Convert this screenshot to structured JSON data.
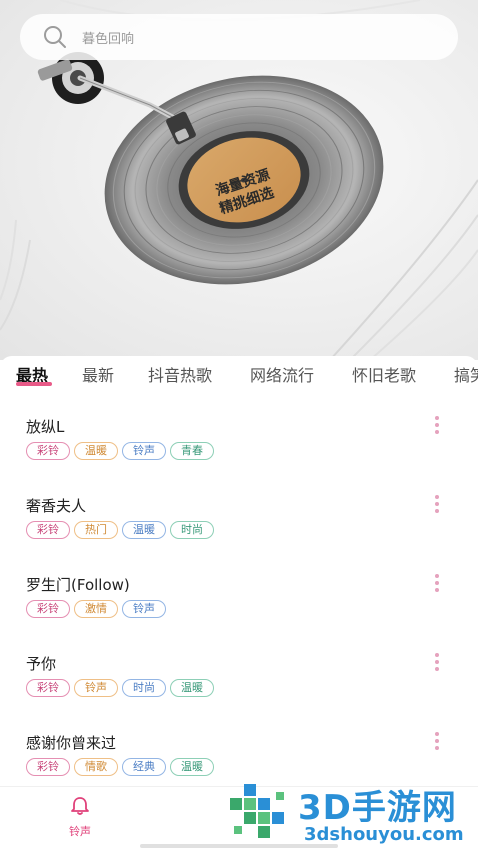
{
  "search": {
    "placeholder": "暮色回响"
  },
  "record": {
    "label_line1": "海量资源",
    "label_line2": "精挑细选"
  },
  "tabs": [
    {
      "label": "最热",
      "active": true
    },
    {
      "label": "最新",
      "active": false
    },
    {
      "label": "抖音热歌",
      "active": false
    },
    {
      "label": "网络流行",
      "active": false
    },
    {
      "label": "怀旧老歌",
      "active": false
    },
    {
      "label": "搞笑",
      "active": false
    }
  ],
  "songs": [
    {
      "title": "放纵L",
      "tags": [
        "彩铃",
        "温暖",
        "铃声",
        "青春"
      ]
    },
    {
      "title": "奢香夫人",
      "tags": [
        "彩铃",
        "热门",
        "温暖",
        "时尚"
      ]
    },
    {
      "title": "罗生门(Follow)",
      "tags": [
        "彩铃",
        "激情",
        "铃声"
      ]
    },
    {
      "title": "予你",
      "tags": [
        "彩铃",
        "铃声",
        "时尚",
        "温暖"
      ]
    },
    {
      "title": "感谢你曾来过",
      "tags": [
        "彩铃",
        "情歌",
        "经典",
        "温暖"
      ]
    }
  ],
  "bottom_nav": {
    "ringtone_label": "铃声",
    "ringtone_icon": "bell-icon"
  },
  "watermark": {
    "title": "3D手游网",
    "url": "3dshouyou.com"
  },
  "colors": {
    "accent": "#e0417a",
    "tab_underline": "#e85a88"
  }
}
